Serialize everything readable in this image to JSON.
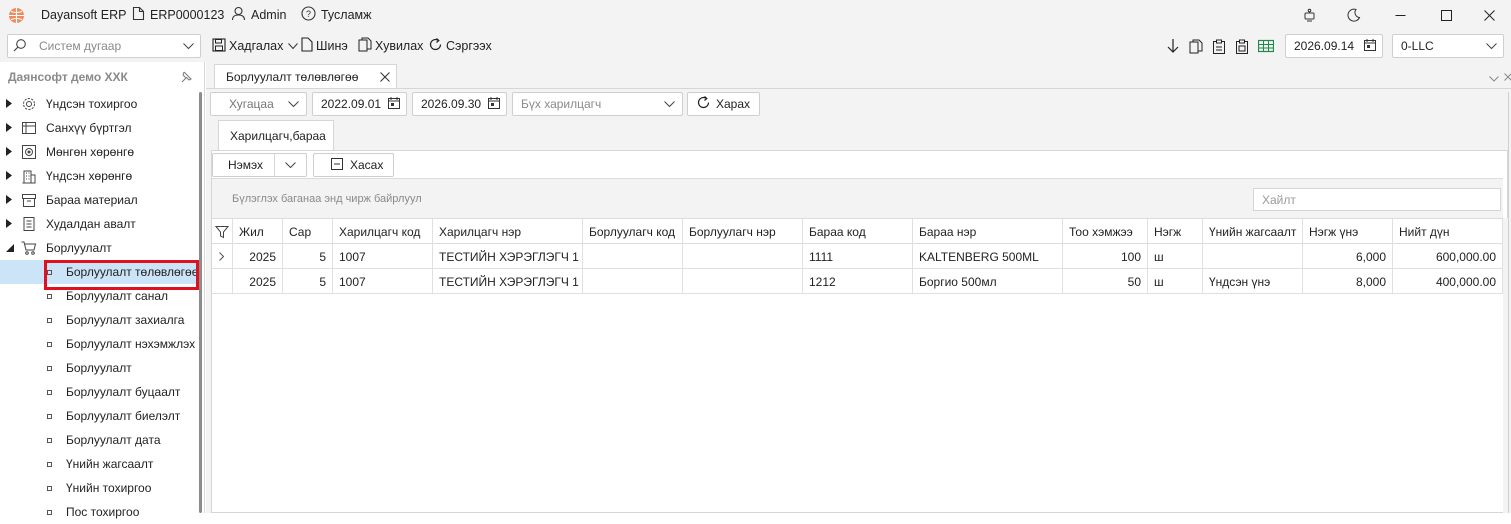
{
  "app": {
    "name": "Dayansoft ERP",
    "code": "ERP0000123",
    "user": "Admin",
    "help": "Тусламж"
  },
  "toolbar": {
    "search_placeholder": "Систем дугаар",
    "save_label": "Хадгалах",
    "new_label": "Шинэ",
    "copy_label": "Хувилах",
    "refresh_label": "Сэргээх",
    "date": "2026.09.14",
    "company": "0-LLC"
  },
  "sidebar": {
    "title": "Даянсофт демо ХХК",
    "items": [
      {
        "label": "Үндсэн тохиргоо",
        "icon": "gear-icon"
      },
      {
        "label": "Санхүү бүртгэл",
        "icon": "ledger-icon"
      },
      {
        "label": "Мөнгөн хөрөнгө",
        "icon": "money-icon"
      },
      {
        "label": "Үндсэн хөрөнгө",
        "icon": "building-icon"
      },
      {
        "label": "Бараа материал",
        "icon": "box-icon"
      },
      {
        "label": "Худалдан авалт",
        "icon": "receipt-icon"
      },
      {
        "label": "Борлуулалт",
        "icon": "cart-icon"
      }
    ],
    "subitems": [
      {
        "label": "Борлуулалт төлөвлөгөө"
      },
      {
        "label": "Борлуулалт санал"
      },
      {
        "label": "Борлуулалт захиалга"
      },
      {
        "label": "Борлуулалт нэхэмжлэх"
      },
      {
        "label": "Борлуулалт"
      },
      {
        "label": "Борлуулалт буцаалт"
      },
      {
        "label": "Борлуулалт биелэлт"
      },
      {
        "label": "Борлуулалт дата"
      },
      {
        "label": "Үнийн жагсаалт"
      },
      {
        "label": "Үнийн тохиргоо"
      },
      {
        "label": "Пос тохиргоо"
      }
    ]
  },
  "doc_tab": {
    "label": "Борлуулалт төлөвлөгөө"
  },
  "filter": {
    "period": "Хугацаа",
    "date_from": "2022.09.01",
    "date_to": "2026.09.30",
    "partner": "Бүх харилцагч",
    "view_label": "Харах"
  },
  "subtab": {
    "label": "Харилцагч,бараа"
  },
  "actions": {
    "add_label": "Нэмэх",
    "delete_label": "Хасах"
  },
  "group_hint": "Бүлэглэх баганаа энд чирж байрлуул",
  "grid_search_placeholder": "Хайлт",
  "grid": {
    "columns": [
      "Жил",
      "Сар",
      "Харилцагч код",
      "Харилцагч нэр",
      "Борлуулагч код",
      "Борлуулагч нэр",
      "Бараа код",
      "Бараа нэр",
      "Тоо хэмжээ",
      "Нэгж",
      "Үнийн жагсаалт",
      "Нэгж үнэ",
      "Нийт дүн"
    ],
    "rows": [
      {
        "year": "2025",
        "month": "5",
        "partner_code": "1007",
        "partner_name": "ТЕСТИЙН ХЭРЭГЛЭГЧ 1",
        "seller_code": "",
        "seller_name": "",
        "item_code": "1111",
        "item_name": "KALTENBERG 500ML",
        "qty": "100",
        "unit": "ш",
        "price_list": "",
        "unit_price": "6,000",
        "total": "600,000.00"
      },
      {
        "year": "2025",
        "month": "5",
        "partner_code": "1007",
        "partner_name": "ТЕСТИЙН ХЭРЭГЛЭГЧ 1",
        "seller_code": "",
        "seller_name": "",
        "item_code": "1212",
        "item_name": "Боргио 500мл",
        "qty": "50",
        "unit": "ш",
        "price_list": "Үндсэн үнэ",
        "unit_price": "8,000",
        "total": "400,000.00"
      }
    ]
  },
  "colors": {
    "accent": "#0078d4",
    "selected_bg": "#cce4f7",
    "highlight_box": "#e0101f"
  }
}
